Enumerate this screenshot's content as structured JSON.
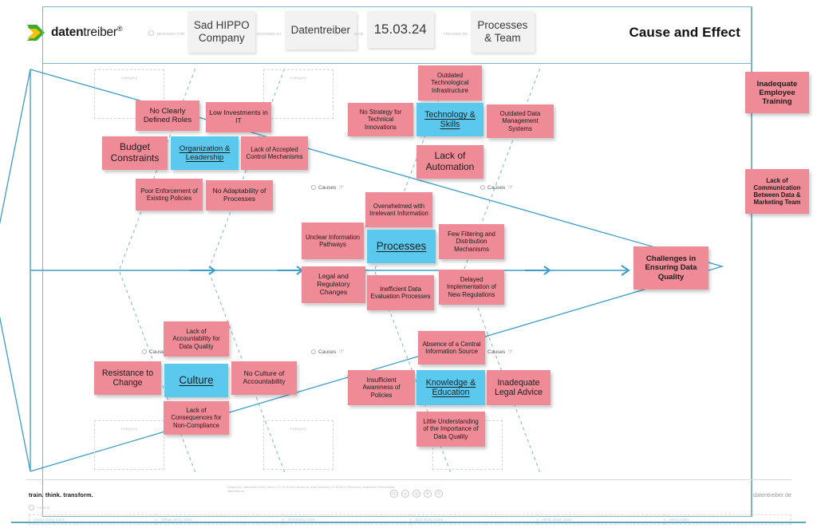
{
  "header": {
    "logo_text_bold": "daten",
    "logo_text_light": "treiber",
    "logo_superscript": "®",
    "fields": [
      {
        "label": "Designed for",
        "value": "Sad HIPPO Company",
        "icon": "clock-icon"
      },
      {
        "label": "Designed by",
        "value": "Datentreiber"
      },
      {
        "label": "Date",
        "value": "15.03.24"
      },
      {
        "label": "Focused on",
        "value": "Processes & Team"
      }
    ],
    "title": "Cause and Effect"
  },
  "board": {
    "category_placeholder_label": "Category",
    "causes_label": "Causes",
    "effect": {
      "text": "Challenges in Ensuring Data Quality",
      "color": "#ef8a97"
    },
    "colors": {
      "red_note": "#ef8a97",
      "blue_note": "#5bc8ee",
      "bone": "#3c9dc6",
      "frame": "#7fb3cc"
    },
    "bones": [
      {
        "id": "organization-leadership",
        "category": "Organization & Leadership",
        "causes": [
          "No Clearly Defined Roles",
          "Low Investments in IT",
          "Budget Constraints",
          "Lack of Accepted Control Mechanisms",
          "Poor Enforcement of Existing Policies",
          "No Adaptability of Processes"
        ]
      },
      {
        "id": "technology-skills",
        "category": "Technology & Skills",
        "causes": [
          "Outdated Technological Infrastructure",
          "No Strategy for Technical Innovations",
          "Outdated Data Management Systems",
          "Lack of Automation"
        ]
      },
      {
        "id": "processes",
        "category": "Processes",
        "causes": [
          "Overwhelmed with Irrelevant Information",
          "Unclear Information Pathways",
          "Few Filtering and Distribution Mechanisms",
          "Legal and Regulatory Changes",
          "Inefficient Data Evaluation Processes",
          "Delayed Implementation of New Regulations"
        ]
      },
      {
        "id": "culture",
        "category": "Culture",
        "causes": [
          "Lack of Accountability for Data Quality",
          "Resistance to Change",
          "No Culture of Accountability",
          "Lack of Consequences for Non-Compliance"
        ]
      },
      {
        "id": "knowledge-education",
        "category": "Knowledge & Education",
        "causes": [
          "Absence of a Central Information Source",
          "Insufficient Awareness of Policies",
          "Inadequate Legal Advice",
          "Little Understanding of the Importance of Data Quality"
        ]
      }
    ],
    "side_notes": [
      "Inadequate Employee Training",
      "Lack of Communication Between Data & Marketing Team"
    ]
  },
  "notes": {
    "n_no_clearly_defined_roles": "No Clearly Defined Roles",
    "n_low_investments_in_it": "Low Investments in IT",
    "n_budget_constraints": "Budget Constraints",
    "n_organization_leadership": "Organization & Leadership",
    "n_lack_accepted_control": "Lack of Accepted Control Mechanisms",
    "n_poor_enforcement": "Poor Enforcement of Existing Policies",
    "n_no_adaptability": "No Adaptability of Processes",
    "n_outdated_tech_infra": "Outdated Technological Infrastructure",
    "n_no_strategy_tech": "No Strategy for Technical Innovations",
    "n_technology_skills": "Technology & Skills",
    "n_outdated_data_mgmt": "Outdated Data Management Systems",
    "n_lack_of_automation": "Lack of Automation",
    "n_overwhelmed_irrelevant": "Overwhelmed with Irrelevant Information",
    "n_unclear_info_pathways": "Unclear Information Pathways",
    "n_processes": "Processes",
    "n_few_filtering": "Few Filtering and Distribution Mechanisms",
    "n_legal_regulatory": "Legal and Regulatory Changes",
    "n_inefficient_data_eval": "Inefficient Data Evaluation Processes",
    "n_delayed_implementation": "Delayed Implementation of New Regulations",
    "n_lack_accountability_dq": "Lack of Accountability for Data Quality",
    "n_resistance_to_change": "Resistance to Change",
    "n_culture": "Culture",
    "n_no_culture_accountability": "No Culture of Accountability",
    "n_lack_consequences": "Lack of Consequences for Non-Compliance",
    "n_absence_central_info": "Absence of a Central Information Source",
    "n_insufficient_awareness": "Insufficient Awareness of Policies",
    "n_knowledge_education": "Knowledge & Education",
    "n_inadequate_legal_advice": "Inadequate Legal Advice",
    "n_little_understanding": "Little Understanding of the Importance of Data Quality",
    "n_effect": "Challenges in Ensuring Data Quality",
    "n_side_1": "Inadequate Employee Training",
    "n_side_2": "Lack of Communication Between Data & Marketing Team"
  },
  "footer": {
    "tagline": "train. think. transform.",
    "legend_label": "Legend",
    "legend_cells": [
      "Green sticky notes",
      "Yellow sticky notes",
      "Red sticky notes",
      "Blue sticky notes",
      "White sticky notes",
      "Sticky notes"
    ],
    "fineprint": "Designed by: Datentreiber GmbH | Version 1.0 | 15.03.2024  Licensed by: Nasim Mehdizad | CC BY-SA 4.0  Provided by: Datentreiber  Free download: datentreiber.de",
    "cc_icons": [
      "cc",
      "by",
      "nc",
      "sa",
      "bullet"
    ],
    "site": "datentreiber.de"
  }
}
